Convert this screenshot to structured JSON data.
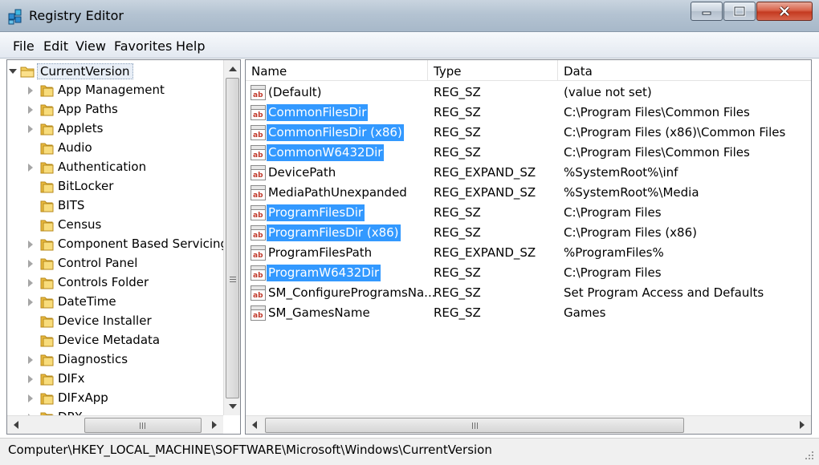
{
  "window": {
    "title": "Registry Editor"
  },
  "menu": [
    "File",
    "Edit",
    "View",
    "Favorites",
    "Help"
  ],
  "tree": {
    "root": "CurrentVersion",
    "items": [
      {
        "label": "App Management",
        "expandable": true
      },
      {
        "label": "App Paths",
        "expandable": true
      },
      {
        "label": "Applets",
        "expandable": true
      },
      {
        "label": "Audio",
        "expandable": false
      },
      {
        "label": "Authentication",
        "expandable": true
      },
      {
        "label": "BitLocker",
        "expandable": false
      },
      {
        "label": "BITS",
        "expandable": false
      },
      {
        "label": "Census",
        "expandable": false
      },
      {
        "label": "Component Based Servicing",
        "expandable": true
      },
      {
        "label": "Control Panel",
        "expandable": true
      },
      {
        "label": "Controls Folder",
        "expandable": true
      },
      {
        "label": "DateTime",
        "expandable": true
      },
      {
        "label": "Device Installer",
        "expandable": false
      },
      {
        "label": "Device Metadata",
        "expandable": false
      },
      {
        "label": "Diagnostics",
        "expandable": true
      },
      {
        "label": "DIFx",
        "expandable": true
      },
      {
        "label": "DIFxApp",
        "expandable": true
      },
      {
        "label": "DPX",
        "expandable": true
      }
    ]
  },
  "list": {
    "columns": [
      "Name",
      "Type",
      "Data"
    ],
    "rows": [
      {
        "name": "(Default)",
        "type": "REG_SZ",
        "data": "(value not set)",
        "selected": false
      },
      {
        "name": "CommonFilesDir",
        "type": "REG_SZ",
        "data": "C:\\Program Files\\Common Files",
        "selected": true
      },
      {
        "name": "CommonFilesDir (x86)",
        "type": "REG_SZ",
        "data": "C:\\Program Files (x86)\\Common Files",
        "selected": true
      },
      {
        "name": "CommonW6432Dir",
        "type": "REG_SZ",
        "data": "C:\\Program Files\\Common Files",
        "selected": true
      },
      {
        "name": "DevicePath",
        "type": "REG_EXPAND_SZ",
        "data": "%SystemRoot%\\inf",
        "selected": false
      },
      {
        "name": "MediaPathUnexpanded",
        "type": "REG_EXPAND_SZ",
        "data": "%SystemRoot%\\Media",
        "selected": false
      },
      {
        "name": "ProgramFilesDir",
        "type": "REG_SZ",
        "data": "C:\\Program Files",
        "selected": true
      },
      {
        "name": "ProgramFilesDir (x86)",
        "type": "REG_SZ",
        "data": "C:\\Program Files (x86)",
        "selected": true
      },
      {
        "name": "ProgramFilesPath",
        "type": "REG_EXPAND_SZ",
        "data": "%ProgramFiles%",
        "selected": false
      },
      {
        "name": "ProgramW6432Dir",
        "type": "REG_SZ",
        "data": "C:\\Program Files",
        "selected": true
      },
      {
        "name": "SM_ConfigureProgramsNa...",
        "type": "REG_SZ",
        "data": "Set Program Access and Defaults",
        "selected": false
      },
      {
        "name": "SM_GamesName",
        "type": "REG_SZ",
        "data": "Games",
        "selected": false
      }
    ]
  },
  "status": {
    "path": "Computer\\HKEY_LOCAL_MACHINE\\SOFTWARE\\Microsoft\\Windows\\CurrentVersion"
  },
  "colors": {
    "selection": "#3399ff",
    "titlebar": "#b4c3d2",
    "close_button": "#c43a20"
  },
  "icons": {
    "app": "registry-icon",
    "folder": "folder-icon",
    "string_value": "reg-string-value-icon"
  }
}
